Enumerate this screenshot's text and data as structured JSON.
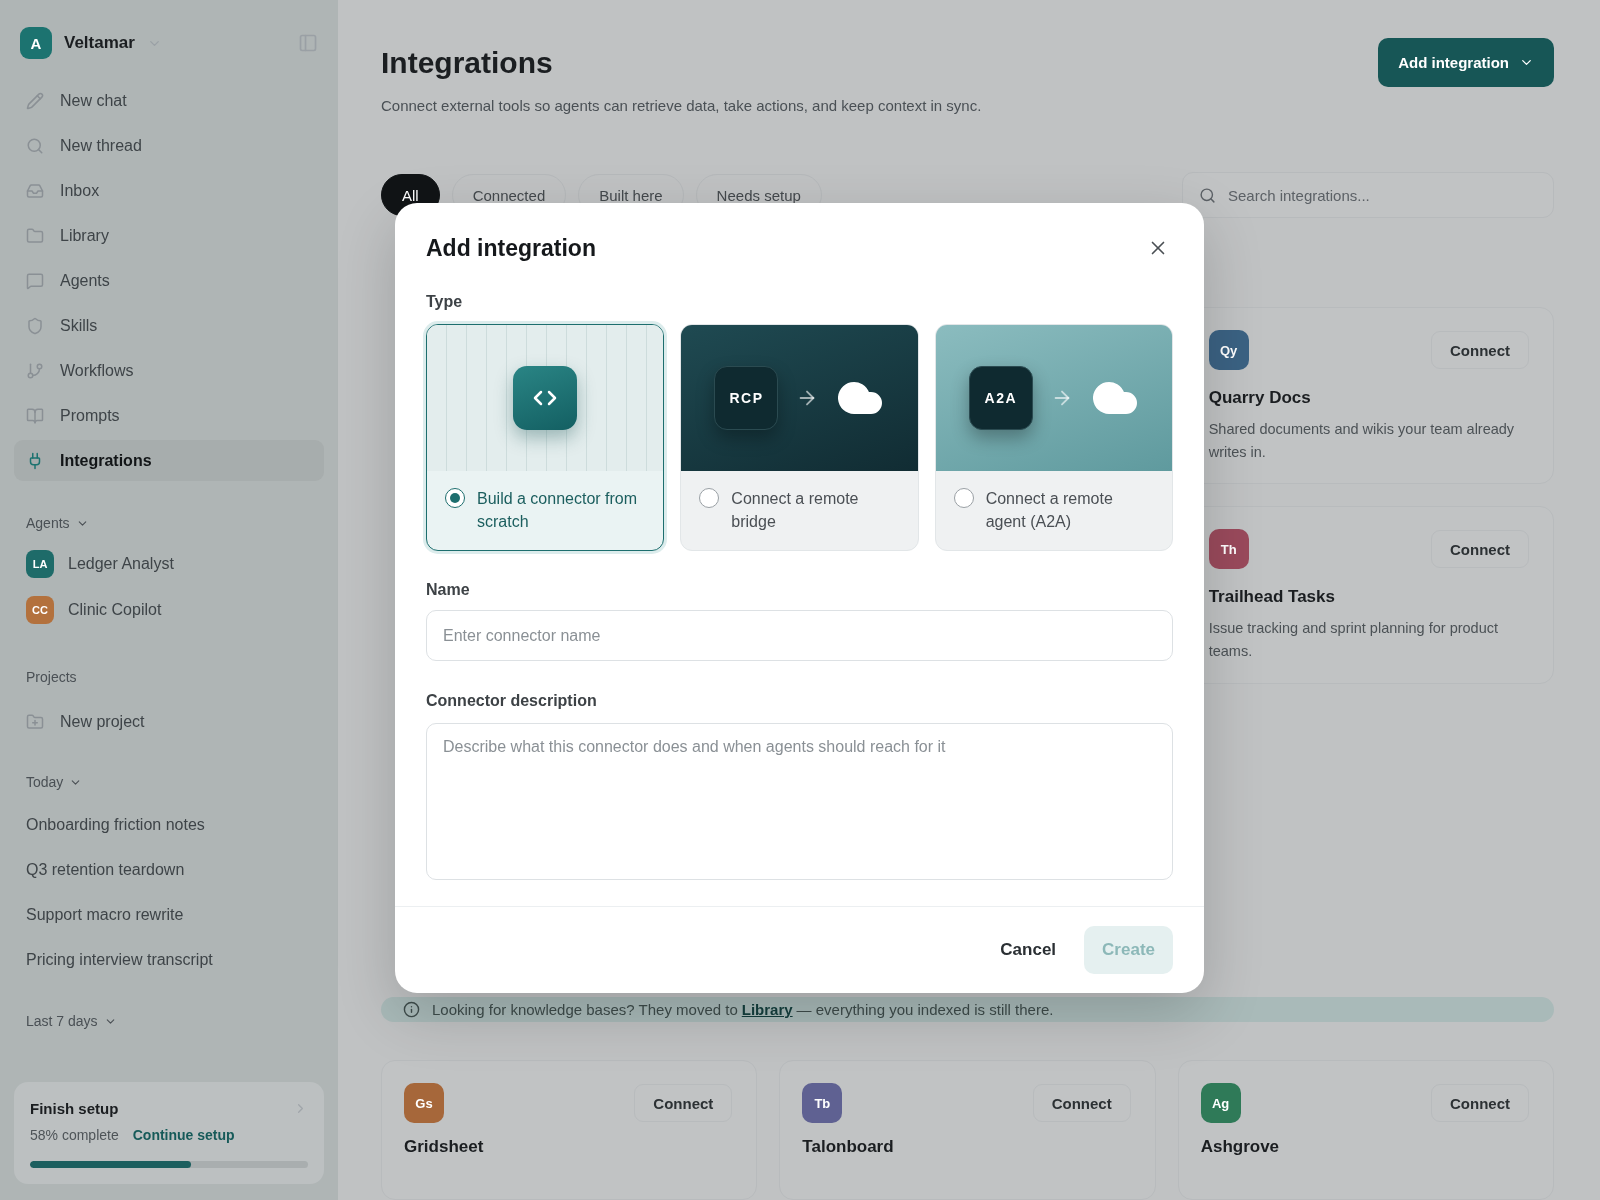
{
  "sidebar": {
    "workspace": {
      "initial": "A",
      "name": "Veltamar"
    },
    "nav": [
      {
        "label": "New chat",
        "selected": false
      },
      {
        "label": "New thread",
        "selected": false
      },
      {
        "label": "Inbox",
        "selected": false
      },
      {
        "label": "Library",
        "selected": false
      },
      {
        "label": "Agents",
        "selected": false
      },
      {
        "label": "Skills",
        "selected": false
      },
      {
        "label": "Workflows",
        "selected": false
      },
      {
        "label": "Prompts",
        "selected": false
      },
      {
        "label": "Integrations",
        "selected": true
      }
    ],
    "agents_header": "Agents",
    "agents": [
      {
        "initials": "LA",
        "name": "Ledger Analyst",
        "color": "#1e6b69"
      },
      {
        "initials": "CC",
        "name": "Clinic Copilot",
        "color": "#b3713d"
      }
    ],
    "projects_header": "Projects",
    "projects": [
      "New project"
    ],
    "history": [
      {
        "header": "Today",
        "items": [
          "Onboarding friction notes",
          "Q3 retention teardown",
          "Support macro rewrite",
          "Pricing interview transcript"
        ]
      },
      {
        "header": "Last 7 days"
      }
    ],
    "setup": {
      "title": "Finish setup",
      "progress": "58% complete",
      "link": "Continue setup",
      "level": 0.58
    }
  },
  "page": {
    "title": "Integrations",
    "subtitle": "Connect external tools so agents can retrieve data, take actions, and keep context in sync.",
    "add_button": "Add integration",
    "filters": [
      {
        "label": "All",
        "selected": true
      },
      {
        "label": "Connected",
        "selected": false
      },
      {
        "label": "Built here",
        "selected": false
      },
      {
        "label": "Needs setup",
        "selected": false
      }
    ],
    "search": {
      "placeholder": "Search integrations..."
    },
    "side_cards": [
      {
        "initials": "Qy",
        "name": "Quarry Docs",
        "description": "Shared documents and wikis your team already writes in.",
        "action": "Connect",
        "color": "#3b6283"
      },
      {
        "initials": "Th",
        "name": "Trailhead Tasks",
        "description": "Issue tracking and sprint planning for product teams.",
        "action": "Connect",
        "color": "#9a4a5c"
      }
    ],
    "notice": {
      "before": "Looking for knowledge bases? They moved to",
      "link": "Library",
      "after": "— everything you indexed is still there."
    },
    "cards": [
      {
        "initials": "Gs",
        "name": "Gridsheet",
        "action": "Connect",
        "color": "#a6673a"
      },
      {
        "initials": "Tb",
        "name": "Talonboard",
        "action": "Connect",
        "color": "#5f6192"
      },
      {
        "initials": "Ag",
        "name": "Ashgrove",
        "action": "Connect",
        "color": "#2f7a58"
      }
    ]
  },
  "dialog": {
    "title": "Add integration",
    "type_label": "Type",
    "options": [
      {
        "kind": "scratch",
        "label": "Build a connector from scratch",
        "selected": true
      },
      {
        "kind": "bridge",
        "badge": "RCP",
        "label": "Connect a remote bridge",
        "selected": false
      },
      {
        "kind": "agent",
        "badge": "A2A",
        "label": "Connect a remote agent (A2A)",
        "selected": false
      }
    ],
    "name": {
      "label": "Name",
      "placeholder": "Enter connector name"
    },
    "description": {
      "label": "Connector description",
      "placeholder": "Describe what this connector does and when agents should reach for it"
    },
    "cancel": "Cancel",
    "create": {
      "label": "Create",
      "disabled": true
    }
  }
}
